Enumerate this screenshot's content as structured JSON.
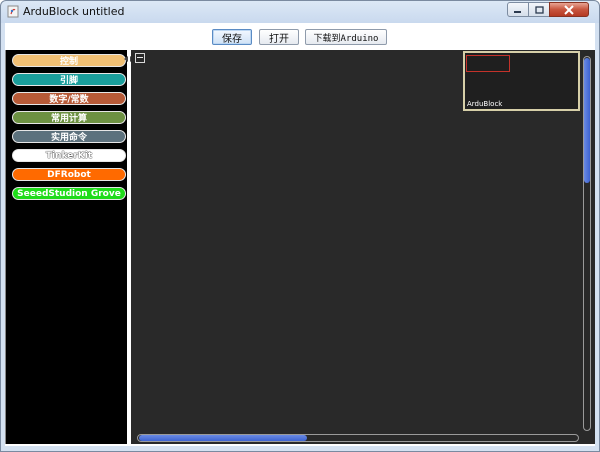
{
  "window": {
    "title": "ArduBlock untitled",
    "controls": [
      "minimize-icon",
      "maximize-icon",
      "close-icon"
    ]
  },
  "toolbar": {
    "save_label": "保存",
    "open_label": "打开",
    "upload_label": "下载到Arduino"
  },
  "palette": {
    "items": [
      {
        "label": "控制",
        "color": "#f1c074"
      },
      {
        "label": "引脚",
        "color": "#1a9e9c"
      },
      {
        "label": "数字/常数",
        "color": "#b75a37"
      },
      {
        "label": "常用计算",
        "color": "#6d9142"
      },
      {
        "label": "实用命令",
        "color": "#5c717d"
      },
      {
        "label": "TinkerKit",
        "color": "#ffffff"
      },
      {
        "label": "DFRobot",
        "color": "#ff6a00"
      },
      {
        "label": "SeeedStudion Grove",
        "color": "#1fdc1a"
      }
    ]
  },
  "minimap": {
    "label": "ArduBlock"
  },
  "colors": {
    "workspace_bg": "#292929",
    "palette_bg": "#000000",
    "scrollbar_thumb": "#4a6fd8"
  }
}
